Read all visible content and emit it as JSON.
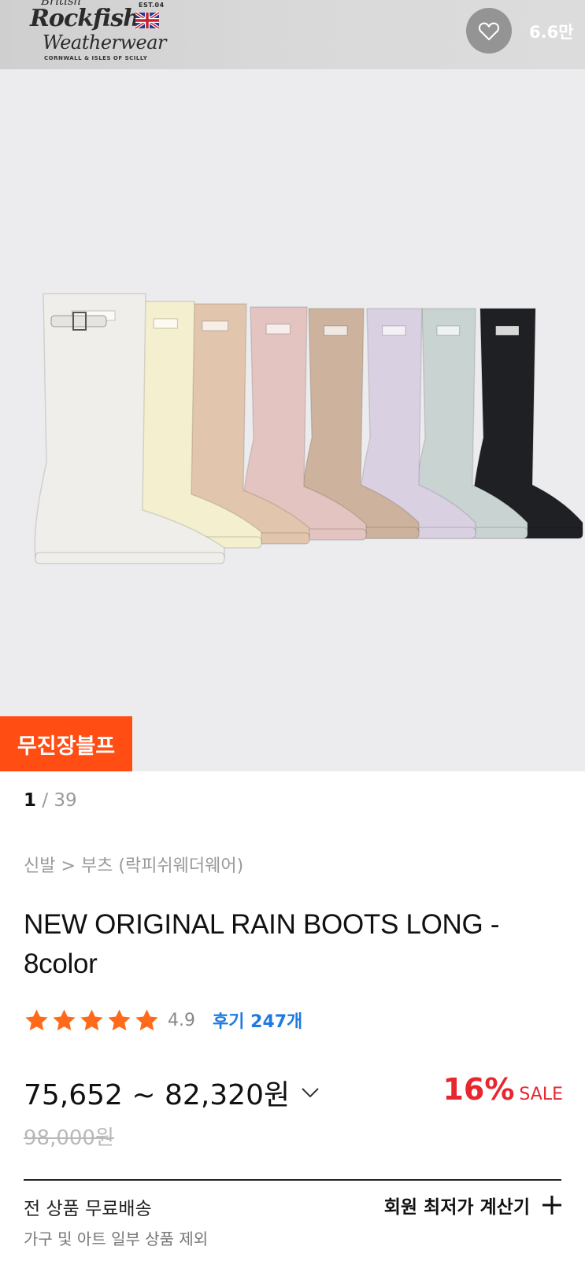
{
  "header": {
    "brand": {
      "british": "British",
      "name": "Rockfish",
      "est": "EST.04",
      "tagline": "Weatherwear",
      "location": "CORNWALL & ISLES OF SCILLY"
    },
    "like_count": "6.6만"
  },
  "gallery": {
    "promo_badge": "무진장블프",
    "current": "1",
    "separator": " / ",
    "total": "39",
    "boot_colors": [
      "#efeeea",
      "#f3efcf",
      "#e2c5ad",
      "#e3c4c0",
      "#cdb39d",
      "#d9d0e2",
      "#c9d4d2",
      "#1f2024"
    ]
  },
  "product": {
    "breadcrumb": "신발 > 부츠 (락피쉬웨더웨어)",
    "title": "NEW ORIGINAL RAIN BOOTS LONG - 8color",
    "rating": {
      "stars": 5,
      "score": "4.9",
      "reviews_label": "후기 247개"
    },
    "price": {
      "range": "75,652 ~ 82,320원",
      "original": "98,000원",
      "discount_percent": "16%",
      "discount_label": "SALE"
    }
  },
  "shipping": {
    "title": "전 상품 무료배송",
    "note": "가구 및 아트 일부 상품 제외",
    "calculator_label": "회원 최저가 계산기"
  },
  "colors": {
    "promo": "#ff4d14",
    "sale": "#e8262e",
    "star": "#ff6a1a",
    "review_link": "#1f7ae0"
  }
}
